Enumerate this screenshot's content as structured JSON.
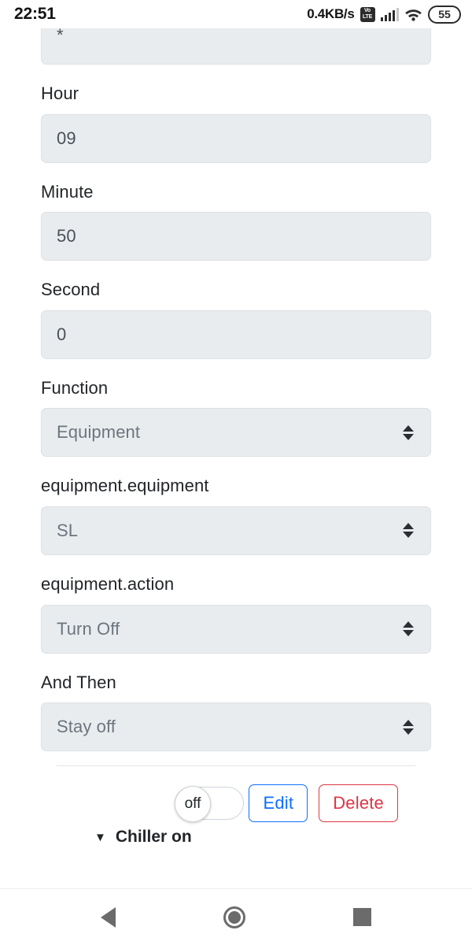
{
  "status_bar": {
    "clock": "22:51",
    "net_speed": "0.4KB/s",
    "volte_top": "Vo",
    "volte_bottom": "LTE",
    "battery_level": "55"
  },
  "form": {
    "fields": [
      {
        "label": "",
        "value": "*",
        "type": "input",
        "clipped": true
      },
      {
        "label": "Hour",
        "value": "09",
        "type": "input"
      },
      {
        "label": "Minute",
        "value": "50",
        "type": "input"
      },
      {
        "label": "Second",
        "value": "0",
        "type": "input"
      },
      {
        "label": "Function",
        "value": "Equipment",
        "type": "select"
      },
      {
        "label": "equipment.equipment",
        "value": "SL",
        "type": "select"
      },
      {
        "label": "equipment.action",
        "value": "Turn Off",
        "type": "select"
      },
      {
        "label": "And Then",
        "value": "Stay off",
        "type": "select"
      }
    ]
  },
  "actions": {
    "toggle_label": "off",
    "toggle_state": "off",
    "edit_label": "Edit",
    "delete_label": "Delete"
  },
  "next_item": {
    "chevron": "▼",
    "title": "Chiller on"
  },
  "colors": {
    "edit": "#0d6efd",
    "delete": "#dc3545",
    "field_bg": "#e9ecef",
    "label_text": "#212529",
    "value_text": "#6c757d"
  }
}
